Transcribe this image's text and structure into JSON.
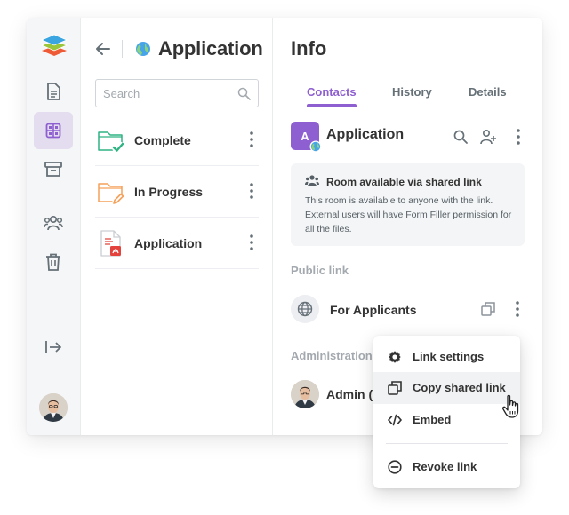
{
  "rail": {
    "items": [
      {
        "name": "documents"
      },
      {
        "name": "rooms",
        "active": true
      },
      {
        "name": "archive"
      },
      {
        "name": "accounts"
      },
      {
        "name": "trash"
      }
    ]
  },
  "files_panel": {
    "title": "Application",
    "search_placeholder": "Search",
    "items": [
      {
        "name": "Complete",
        "icon": "folder-check-icon",
        "color": "#2db482"
      },
      {
        "name": "In Progress",
        "icon": "folder-edit-icon",
        "color": "#f5a15a"
      },
      {
        "name": "Application",
        "icon": "pdf-form-icon",
        "color": "#e4433d"
      }
    ]
  },
  "info_panel": {
    "title": "Info",
    "tabs": [
      {
        "label": "Contacts",
        "active": true
      },
      {
        "label": "History"
      },
      {
        "label": "Details"
      }
    ],
    "room": {
      "badge": "A",
      "name": "Application"
    },
    "notice": {
      "title": "Room available via shared link",
      "text": "This room is available to anyone with the link. External users will have Form Filler permission for all the files."
    },
    "public_link_label": "Public link",
    "public_link_name": "For Applicants",
    "admin_section_label": "Administration",
    "admin_name": "Admin ("
  },
  "context_menu": {
    "items": [
      {
        "label": "Link settings",
        "icon": "gear-icon"
      },
      {
        "label": "Copy shared link",
        "icon": "copy-icon",
        "hovered": true
      },
      {
        "label": "Embed",
        "icon": "code-icon"
      },
      {
        "label": "Revoke link",
        "icon": "minus-circle-icon"
      }
    ]
  },
  "colors": {
    "accent": "#8e5fd0",
    "text": "#333333",
    "muted": "#a3a9ae",
    "green_folder": "#2db482",
    "orange_folder": "#f5a15a",
    "pdf_red": "#e4433d"
  }
}
